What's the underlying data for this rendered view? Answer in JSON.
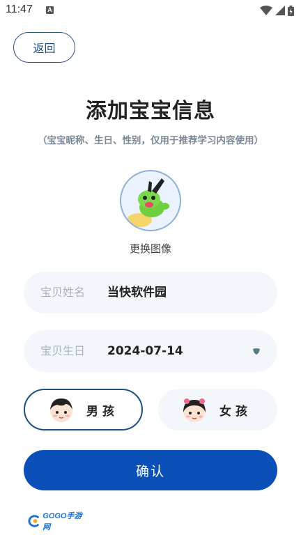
{
  "status": {
    "time": "11:47",
    "notification_glyph": "A"
  },
  "header": {
    "back_label": "返回"
  },
  "page": {
    "title": "添加宝宝信息",
    "subtitle": "（宝宝昵称、生日、性别，仅用于推荐学习内容使用）"
  },
  "avatar": {
    "change_label": "更换图像"
  },
  "form": {
    "name_label": "宝贝姓名",
    "name_value": "当快软件园",
    "birthday_label": "宝贝生日",
    "birthday_value": "2024-07-14"
  },
  "gender": {
    "boy_label": "男孩",
    "girl_label": "女孩",
    "selected": "boy"
  },
  "actions": {
    "confirm_label": "确认"
  },
  "watermark": {
    "text": "GOGO手游网"
  },
  "colors": {
    "accent": "#0b4fb8",
    "outline": "#1f4f86",
    "field_bg": "#f3f7fb",
    "muted_text": "#aab3bd"
  }
}
